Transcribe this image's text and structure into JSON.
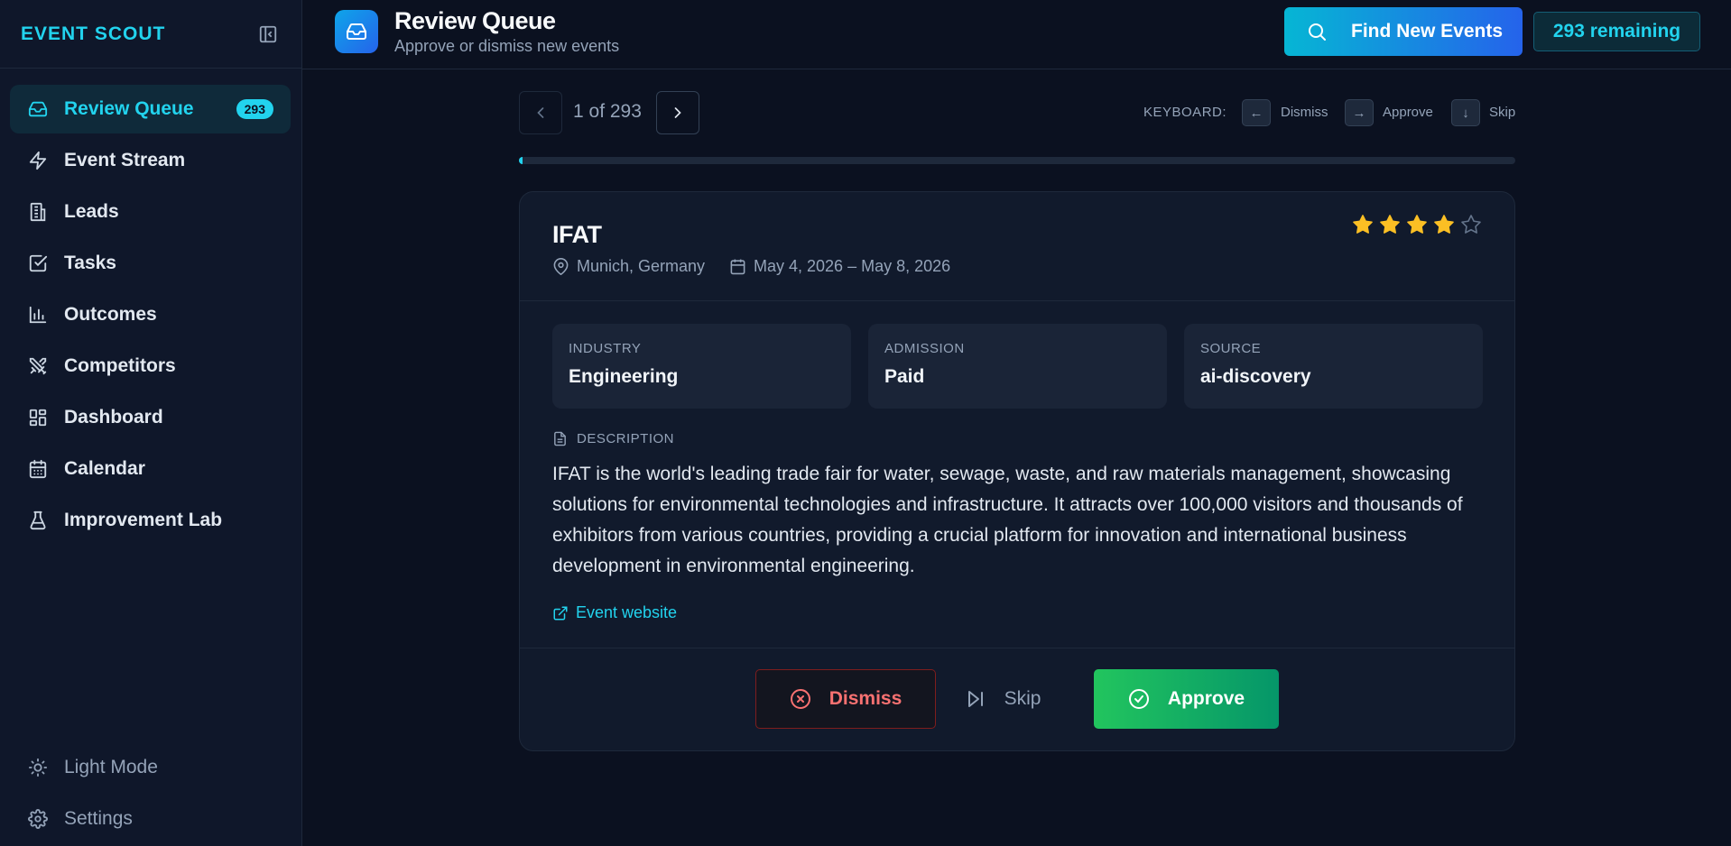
{
  "brand": "EVENT SCOUT",
  "sidebar": {
    "items": [
      {
        "label": "Review Queue",
        "icon": "inbox-icon",
        "badge": "293",
        "active": true
      },
      {
        "label": "Event Stream",
        "icon": "zap-icon"
      },
      {
        "label": "Leads",
        "icon": "building-icon"
      },
      {
        "label": "Tasks",
        "icon": "checkbox-icon"
      },
      {
        "label": "Outcomes",
        "icon": "bar-chart-icon"
      },
      {
        "label": "Competitors",
        "icon": "swords-icon"
      },
      {
        "label": "Dashboard",
        "icon": "grid-icon"
      },
      {
        "label": "Calendar",
        "icon": "calendar-icon"
      },
      {
        "label": "Improvement Lab",
        "icon": "flask-icon"
      }
    ],
    "bottom": [
      {
        "label": "Light Mode",
        "icon": "sun-icon"
      },
      {
        "label": "Settings",
        "icon": "gear-icon"
      }
    ]
  },
  "header": {
    "title": "Review Queue",
    "subtitle": "Approve or dismiss new events",
    "find_button": "Find New Events",
    "remaining": "293 remaining"
  },
  "pager": {
    "text": "1 of 293",
    "progress": 0.0034
  },
  "keyboard": {
    "label": "KEYBOARD:",
    "shortcuts": [
      {
        "key": "←",
        "action": "Dismiss"
      },
      {
        "key": "→",
        "action": "Approve"
      },
      {
        "key": "↓",
        "action": "Skip"
      }
    ]
  },
  "event": {
    "title": "IFAT",
    "location": "Munich, Germany",
    "dates": "May 4, 2026 – May 8, 2026",
    "rating": 4,
    "rating_max": 5,
    "info": [
      {
        "label": "INDUSTRY",
        "value": "Engineering"
      },
      {
        "label": "ADMISSION",
        "value": "Paid"
      },
      {
        "label": "SOURCE",
        "value": "ai-discovery"
      }
    ],
    "description_label": "DESCRIPTION",
    "description": "IFAT is the world's leading trade fair for water, sewage, waste, and raw materials management, showcasing solutions for environmental technologies and infrastructure. It attracts over 100,000 visitors and thousands of exhibitors from various countries, providing a crucial platform for innovation and international business development in environmental engineering.",
    "website_label": "Event website"
  },
  "actions": {
    "dismiss": "Dismiss",
    "skip": "Skip",
    "approve": "Approve"
  },
  "colors": {
    "accent": "#22d3ee",
    "background": "#0b1120",
    "sidebar": "#0f172a",
    "card": "#111a2c",
    "approve": "#22c55e",
    "dismiss": "#f87171",
    "star": "#fbbf24"
  }
}
